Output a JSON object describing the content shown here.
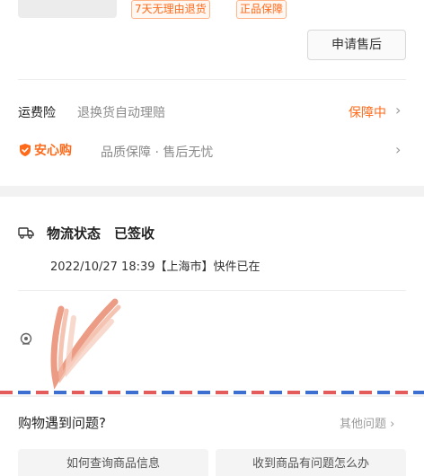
{
  "order": {
    "tags": [
      "7天无理由退货",
      "正品保障"
    ],
    "apply_button": "申请售后"
  },
  "insurance": {
    "label": "运费险",
    "description": "退换货自动理赔",
    "status": "保障中",
    "chevron": "›"
  },
  "assurance": {
    "brand": "安心购",
    "description": "品质保障 · 售后无忧",
    "chevron": "›"
  },
  "logistics": {
    "title": "物流状态　已签收",
    "detail": "2022/10/27 18:39【上海市】快件已在"
  },
  "help": {
    "title": "购物遇到问题?",
    "more": "其他问题 ›",
    "buttons": [
      "如何查询商品信息",
      "收到商品有问题怎么办"
    ]
  },
  "colors": {
    "accent": "#ff6a1a",
    "airmail_red": "#e45b5b",
    "airmail_blue": "#3d6fd1"
  }
}
